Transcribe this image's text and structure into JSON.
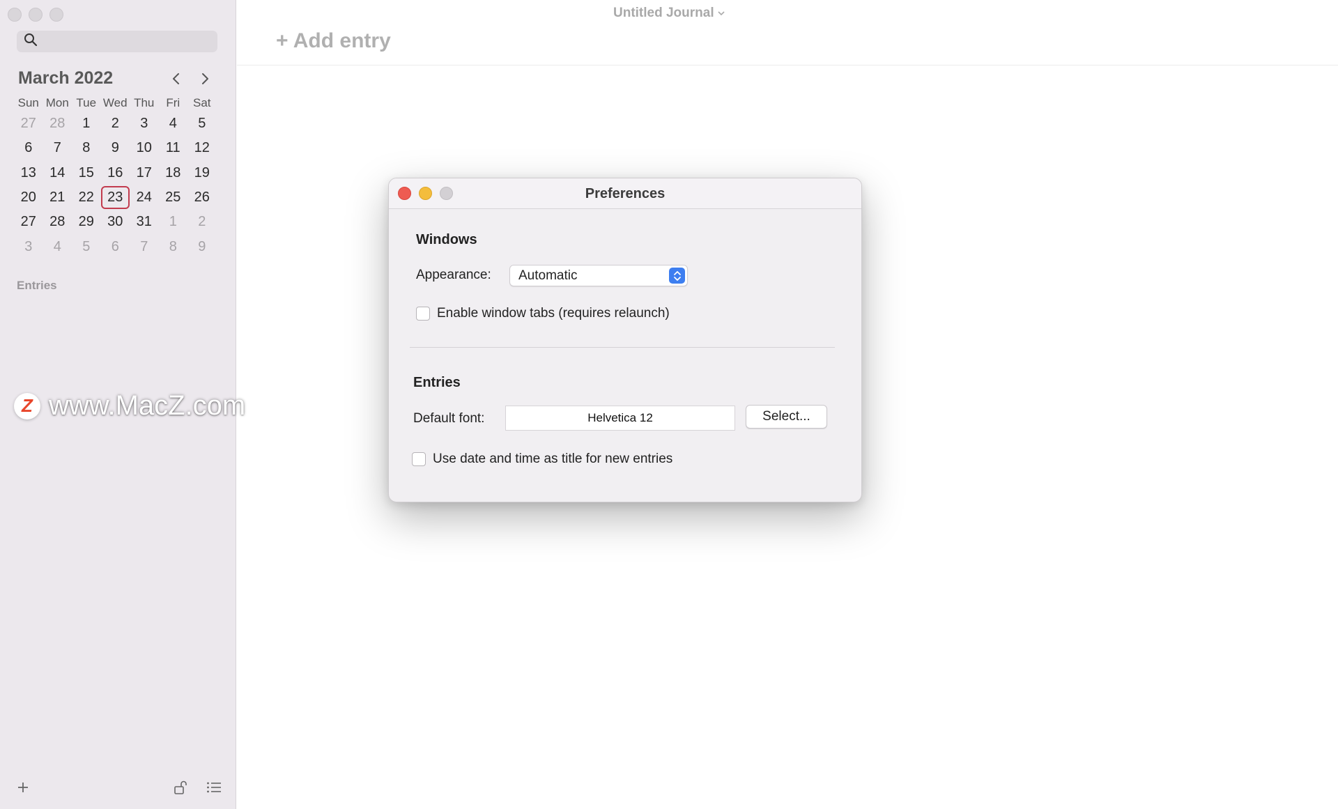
{
  "sidebar": {
    "search": {
      "placeholder": "",
      "value": ""
    },
    "calendar": {
      "month_title": "March 2022",
      "weekdays": [
        "Sun",
        "Mon",
        "Tue",
        "Wed",
        "Thu",
        "Fri",
        "Sat"
      ],
      "weeks": [
        [
          "27",
          "28",
          "1",
          "2",
          "3",
          "4",
          "5"
        ],
        [
          "6",
          "7",
          "8",
          "9",
          "10",
          "11",
          "12"
        ],
        [
          "13",
          "14",
          "15",
          "16",
          "17",
          "18",
          "19"
        ],
        [
          "20",
          "21",
          "22",
          "23",
          "24",
          "25",
          "26"
        ],
        [
          "27",
          "28",
          "29",
          "30",
          "31",
          "1",
          "2"
        ],
        [
          "3",
          "4",
          "5",
          "6",
          "7",
          "8",
          "9"
        ]
      ],
      "selected_day": "23"
    },
    "entries_label": "Entries"
  },
  "watermark": {
    "text": "www.MacZ.com",
    "logo_letter": "Z"
  },
  "main": {
    "journal_title": "Untitled Journal",
    "add_entry_label": "+ Add entry"
  },
  "preferences": {
    "title": "Preferences",
    "windows_section": "Windows",
    "appearance_label": "Appearance:",
    "appearance_value": "Automatic",
    "window_tabs_label": "Enable window tabs (requires relaunch)",
    "window_tabs_checked": false,
    "entries_section": "Entries",
    "default_font_label": "Default font:",
    "default_font_value": "Helvetica 12",
    "select_button_label": "Select...",
    "date_title_label": "Use date and time as title for new entries",
    "date_title_checked": false
  },
  "colors": {
    "sidebar_bg": "#ece8ed",
    "today_ring": "#c23b4e",
    "popup_accent": "#3d7ef0",
    "close_red": "#ee5b52",
    "minimize_yellow": "#f4bd3c"
  }
}
